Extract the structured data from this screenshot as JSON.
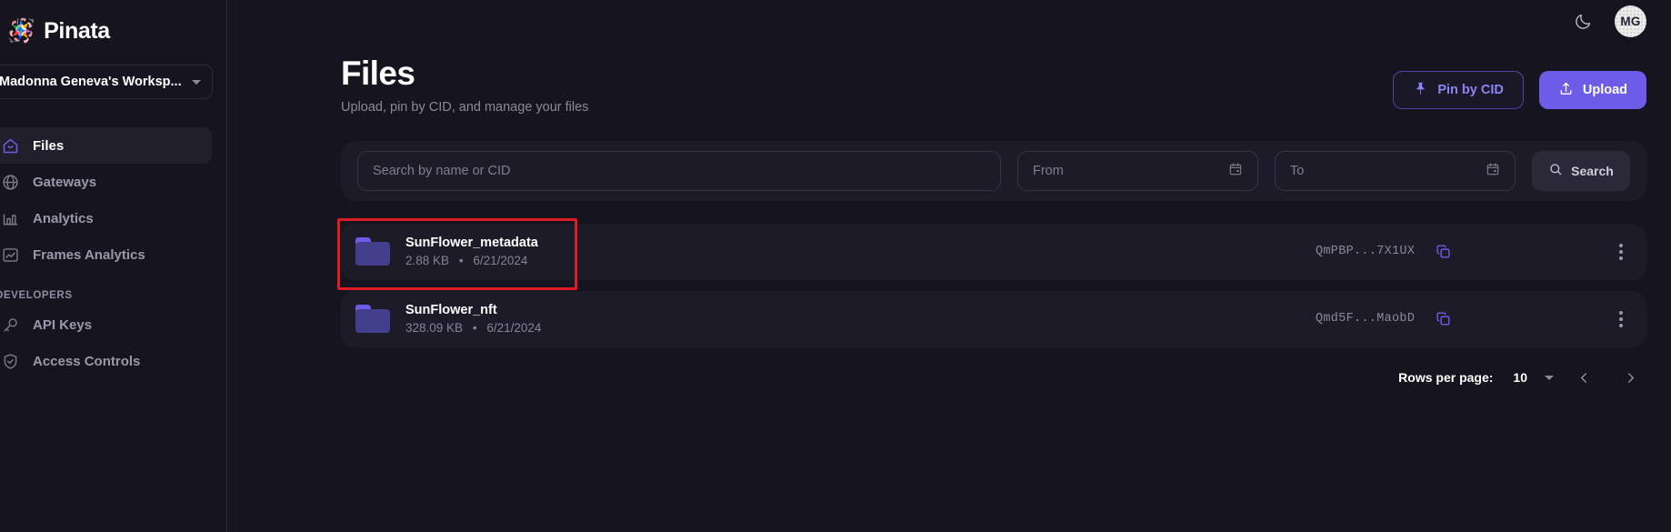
{
  "brand": {
    "logo_icon": "pinata-icon",
    "name": "Pinata"
  },
  "workspace": {
    "label": "Madonna Geneva's Worksp...",
    "caret_icon": "chevron-down-icon"
  },
  "sidebar": {
    "items": [
      {
        "label": "Files",
        "icon": "home-icon",
        "active": true
      },
      {
        "label": "Gateways",
        "icon": "globe-icon",
        "active": false
      },
      {
        "label": "Analytics",
        "icon": "bar-chart-icon",
        "active": false
      },
      {
        "label": "Frames Analytics",
        "icon": "image-chart-icon",
        "active": false
      }
    ],
    "section_label": "DEVELOPERS",
    "dev_items": [
      {
        "label": "API Keys",
        "icon": "key-icon"
      },
      {
        "label": "Access Controls",
        "icon": "shield-check-icon"
      }
    ]
  },
  "topbar": {
    "theme_toggle_icon": "moon-icon",
    "avatar_initials": "MG"
  },
  "header": {
    "title": "Files",
    "subtitle": "Upload, pin by CID, and manage your files",
    "pin_button": {
      "label": "Pin by CID",
      "icon": "pin-icon"
    },
    "upload_button": {
      "label": "Upload",
      "icon": "upload-icon"
    }
  },
  "search": {
    "placeholder": "Search by name or CID",
    "value": "",
    "from_placeholder": "From",
    "from_value": "",
    "to_placeholder": "To",
    "to_value": "",
    "calendar_icon": "calendar-icon",
    "search_button": {
      "label": "Search",
      "icon": "search-icon"
    }
  },
  "files": [
    {
      "name": "SunFlower_metadata",
      "size": "2.88 KB",
      "separator": "•",
      "date": "6/21/2024",
      "cid": "QmPBP...7X1UX",
      "copy_icon": "copy-icon",
      "menu_icon": "more-vertical-icon",
      "folder_icon": "folder-icon"
    },
    {
      "name": "SunFlower_nft",
      "size": "328.09 KB",
      "separator": "•",
      "date": "6/21/2024",
      "cid": "Qmd5F...MaobD",
      "copy_icon": "copy-icon",
      "menu_icon": "more-vertical-icon",
      "folder_icon": "folder-icon"
    }
  ],
  "pagination": {
    "rows_per_page_label": "Rows per page:",
    "rows_per_page_value": "10",
    "caret_icon": "chevron-down-icon",
    "prev_icon": "chevron-left-icon",
    "next_icon": "chevron-right-icon"
  },
  "colors": {
    "accent": "#6c5ce7",
    "accent_light": "#8b84f7",
    "background": "#16151f",
    "surface": "#1d1b27",
    "annotation": "#e01b24",
    "folder_tab": "#6c5ce7",
    "folder_body": "#433f8c"
  }
}
